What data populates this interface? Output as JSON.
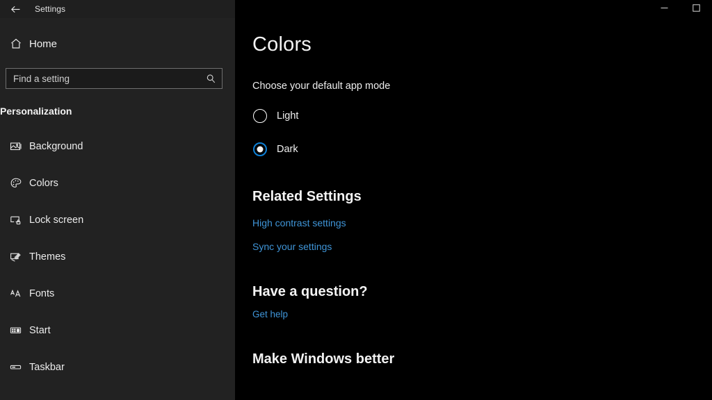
{
  "window": {
    "title": "Settings",
    "back_icon": "back-arrow-icon",
    "minimize_label": "Minimize",
    "maximize_label": "Maximize"
  },
  "sidebar": {
    "home": {
      "label": "Home",
      "icon": "home-icon"
    },
    "search": {
      "placeholder": "Find a setting",
      "value": "",
      "icon": "search-icon"
    },
    "section_title": "Personalization",
    "items": [
      {
        "label": "Background",
        "icon": "image-icon",
        "selected": false
      },
      {
        "label": "Colors",
        "icon": "palette-icon",
        "selected": false
      },
      {
        "label": "Lock screen",
        "icon": "lock-screen-icon",
        "selected": false
      },
      {
        "label": "Themes",
        "icon": "themes-brush-icon",
        "selected": false
      },
      {
        "label": "Fonts",
        "icon": "fonts-aa-icon",
        "selected": false
      },
      {
        "label": "Start",
        "icon": "start-grid-icon",
        "selected": false
      },
      {
        "label": "Taskbar",
        "icon": "taskbar-icon",
        "selected": false
      }
    ]
  },
  "main": {
    "page_title": "Colors",
    "app_mode": {
      "label": "Choose your default app mode",
      "options": [
        {
          "label": "Light",
          "checked": false
        },
        {
          "label": "Dark",
          "checked": true
        }
      ]
    },
    "related_settings": {
      "heading": "Related Settings",
      "links": [
        "High contrast settings",
        "Sync your settings"
      ]
    },
    "question": {
      "heading": "Have a question?",
      "link": "Get help"
    },
    "feedback": {
      "heading": "Make Windows better"
    }
  },
  "colors": {
    "sidebar_bg": "#222222",
    "content_bg": "#000000",
    "accent": "#0e7fd4",
    "link": "#3f95d8",
    "text": "#f0f0f0"
  }
}
